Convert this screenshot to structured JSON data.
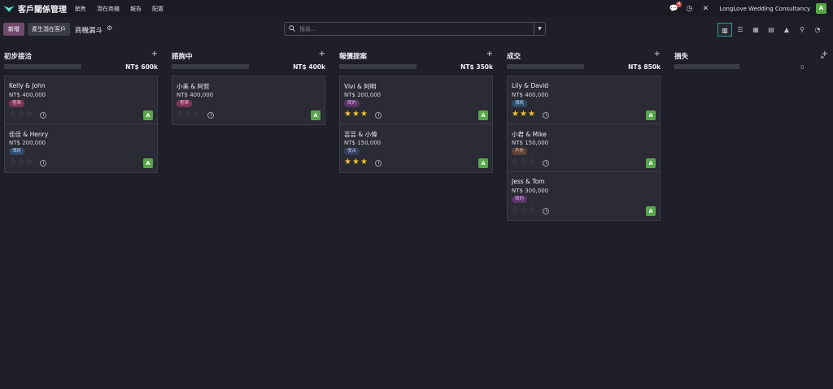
{
  "nav": {
    "app_title": "客戶關係管理",
    "menu": [
      "銷售",
      "潛在商機",
      "報告",
      "配置"
    ],
    "message_count": "4",
    "company": "LongLove Wedding Consultancy",
    "user_initial": "A"
  },
  "control": {
    "new_label": "新增",
    "generate_label": "產生潛在客戶",
    "breadcrumb": "商機漏斗",
    "search_placeholder": "搜尋..."
  },
  "colors": {
    "accent": "#6f4b6b",
    "avatar": "#57a748",
    "star": "#f3c033",
    "view_active_border": "#2aa198"
  },
  "columns": [
    {
      "title": "初步接洽",
      "total": "NT$ 600k",
      "cards": [
        {
          "name": "Kelly & John",
          "amount": "NT$ 400,000",
          "tag": "奢華",
          "tag_color": "#7a3655",
          "tag_text": "#f2a6c3",
          "stars": 0,
          "avatar": "A"
        },
        {
          "name": "佳佳 & Henry",
          "amount": "NT$ 200,000",
          "tag": "傳統",
          "tag_color": "#2d4a66",
          "tag_text": "#a6cdf2",
          "stars": 0,
          "avatar": "A"
        }
      ]
    },
    {
      "title": "諮詢中",
      "total": "NT$ 400k",
      "cards": [
        {
          "name": "小美 & 阿哲",
          "amount": "NT$ 400,000",
          "tag": "奢華",
          "tag_color": "#7a3655",
          "tag_text": "#f2a6c3",
          "stars": 0,
          "avatar": "A"
        }
      ]
    },
    {
      "title": "報價提案",
      "total": "NT$ 350k",
      "cards": [
        {
          "name": "Vivi & 阿明",
          "amount": "NT$ 200,000",
          "tag": "簡約",
          "tag_color": "#5a3466",
          "tag_text": "#dfa6f2",
          "stars": 3,
          "avatar": "A"
        },
        {
          "name": "芸芸 & 小偉",
          "amount": "NT$ 150,000",
          "tag": "復古",
          "tag_color": "#35405f",
          "tag_text": "#b6c2ef",
          "stars": 3,
          "avatar": "A"
        }
      ]
    },
    {
      "title": "成交",
      "total": "NT$ 850k",
      "cards": [
        {
          "name": "Lily & David",
          "amount": "NT$ 400,000",
          "tag": "傳統",
          "tag_color": "#2d4a66",
          "tag_text": "#a6cdf2",
          "stars": 3,
          "avatar": "A"
        },
        {
          "name": "小君 & Mike",
          "amount": "NT$ 150,000",
          "tag": "戶外",
          "tag_color": "#5e4236",
          "tag_text": "#efc2a8",
          "stars": 0,
          "avatar": "A"
        },
        {
          "name": "Jess & Tom",
          "amount": "NT$ 300,000",
          "tag": "簡約",
          "tag_color": "#5a3466",
          "tag_text": "#dfa6f2",
          "stars": 0,
          "avatar": "A"
        }
      ]
    },
    {
      "title": "損失",
      "total": "0",
      "cards": []
    }
  ]
}
